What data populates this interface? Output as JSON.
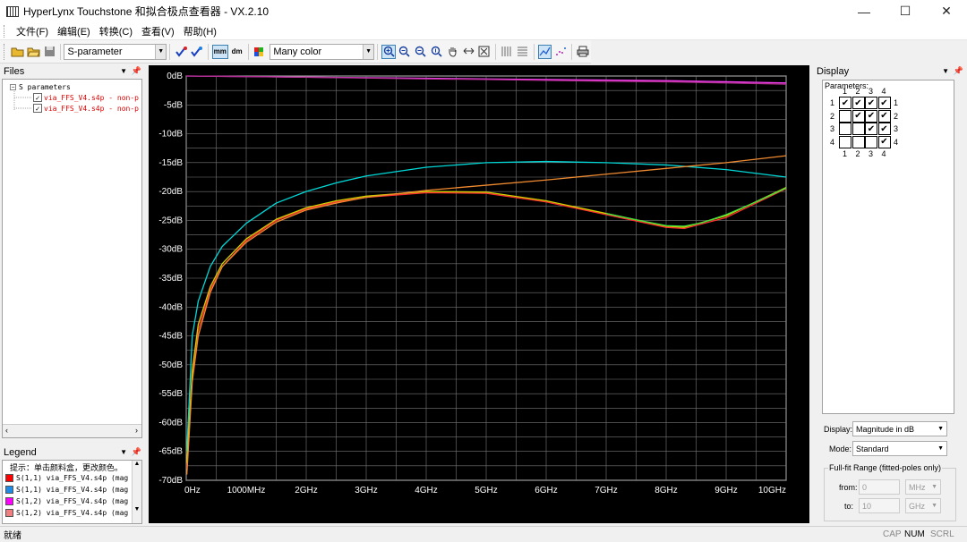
{
  "window": {
    "title": "HyperLynx Touchstone 和拟合极点查看器 - VX.2.10",
    "minimize": "—",
    "maximize": "☐",
    "close": "✕"
  },
  "menu": [
    "文件(F)",
    "编辑(E)",
    "转换(C)",
    "查看(V)",
    "帮助(H)"
  ],
  "toolbar": {
    "param_type": "S-parameter",
    "color_mode": "Many color",
    "mm_label": "mm",
    "dm_label": "dm"
  },
  "files_panel": {
    "title": "Files",
    "root": "S parameters",
    "files": [
      "via_FFS_V4.s4p - non-p",
      "via_FFS_V4.s4p - non-p"
    ]
  },
  "legend_panel": {
    "title": "Legend",
    "hint": "提示：单击颜料盒，更改颜色。",
    "entries": [
      {
        "label": "S(1,1) via_FFS_V4.s4p (mag",
        "color": "#ff0000"
      },
      {
        "label": "S(1,1) via_FFS_V4.s4p (mag",
        "color": "#1e8ce6"
      },
      {
        "label": "S(1,2) via_FFS_V4.s4p (mag",
        "color": "#ff00ff"
      },
      {
        "label": "S(1,2) via_FFS_V4.s4p (mag",
        "color": "#f08080"
      }
    ]
  },
  "chart_data": {
    "type": "line",
    "xlabel": "",
    "ylabel": "",
    "xlim": [
      0,
      10
    ],
    "ylim": [
      -70,
      0
    ],
    "x_ticks": [
      "0Hz",
      "1000MHz",
      "2GHz",
      "3GHz",
      "4GHz",
      "5GHz",
      "6GHz",
      "7GHz",
      "8GHz",
      "9GHz",
      "10GHz"
    ],
    "y_ticks": [
      "0dB",
      "-5dB",
      "-10dB",
      "-15dB",
      "-20dB",
      "-25dB",
      "-30dB",
      "-35dB",
      "-40dB",
      "-45dB",
      "-50dB",
      "-55dB",
      "-60dB",
      "-65dB",
      "-70dB"
    ],
    "grid": true,
    "x_units": "GHz",
    "series": [
      {
        "color": "#00d8d8",
        "x": [
          0.01,
          0.1,
          0.2,
          0.4,
          0.6,
          1,
          1.5,
          2,
          2.5,
          3,
          4,
          5,
          6,
          7,
          8,
          9,
          10
        ],
        "y": [
          -65,
          -45,
          -39,
          -33,
          -29.5,
          -25.5,
          -22,
          -20,
          -18.5,
          -17.3,
          -15.8,
          -15.0,
          -14.8,
          -15.0,
          -15.4,
          -16.2,
          -17.5
        ]
      },
      {
        "color": "#ff3030",
        "x": [
          0.01,
          0.1,
          0.2,
          0.4,
          0.6,
          1,
          1.5,
          2,
          2.5,
          3,
          4,
          5,
          6,
          7,
          8,
          8.3,
          9,
          10
        ],
        "y": [
          -68,
          -52,
          -44,
          -37,
          -33,
          -28.5,
          -25,
          -23,
          -21.8,
          -21,
          -20.2,
          -20.3,
          -21.8,
          -24,
          -26.2,
          -26.4,
          -24.5,
          -19.5
        ]
      },
      {
        "color": "#d0d000",
        "x": [
          0.01,
          0.1,
          0.2,
          0.4,
          0.6,
          1,
          1.5,
          2,
          2.5,
          3,
          4,
          5,
          6,
          7,
          8,
          8.3,
          9,
          10
        ],
        "y": [
          -67,
          -51,
          -43,
          -36.5,
          -32.5,
          -28.2,
          -24.8,
          -22.8,
          -21.6,
          -20.8,
          -20.0,
          -20.1,
          -21.6,
          -23.8,
          -26.0,
          -26.2,
          -24.2,
          -19.3
        ]
      },
      {
        "color": "#40e040",
        "x": [
          7,
          7.5,
          8,
          8.3,
          8.6,
          9,
          9.5,
          10
        ],
        "y": [
          -23.8,
          -24.9,
          -25.9,
          -26.0,
          -25.4,
          -24.0,
          -21.8,
          -19.4
        ]
      },
      {
        "color": "#f08a30",
        "x": [
          0.01,
          0.1,
          0.2,
          0.4,
          0.6,
          1,
          1.5,
          2,
          2.5,
          3,
          4,
          5,
          6,
          7,
          8,
          9,
          10
        ],
        "y": [
          -69,
          -53,
          -45,
          -37.5,
          -33,
          -28.8,
          -25.3,
          -23.2,
          -22,
          -21,
          -19.8,
          -18.9,
          -18.0,
          -17.0,
          -16.0,
          -15.0,
          -13.8
        ]
      },
      {
        "color": "#ff40ff",
        "x": [
          0,
          1,
          2,
          3,
          4,
          5,
          6,
          7,
          8,
          9,
          10
        ],
        "y": [
          0,
          -0.1,
          -0.2,
          -0.3,
          -0.4,
          -0.5,
          -0.6,
          -0.7,
          -0.8,
          -1.0,
          -1.2
        ]
      },
      {
        "color": "#b03090",
        "x": [
          0,
          1,
          2,
          3,
          4,
          5,
          6,
          7,
          8,
          9,
          10
        ],
        "y": [
          0,
          -0.1,
          -0.2,
          -0.35,
          -0.5,
          -0.6,
          -0.75,
          -0.9,
          -1.0,
          -1.2,
          -1.4
        ]
      }
    ]
  },
  "display_panel": {
    "title": "Display",
    "parameters_label": "Parameters:",
    "matrix": [
      [
        true,
        true,
        true,
        true
      ],
      [
        false,
        true,
        true,
        true
      ],
      [
        false,
        false,
        true,
        true
      ],
      [
        false,
        false,
        false,
        true
      ]
    ],
    "col_labels": [
      "1",
      "2",
      "3",
      "4"
    ],
    "row_labels": [
      "1",
      "2",
      "3",
      "4"
    ],
    "display_label": "Display:",
    "display_value": "Magnitude in dB",
    "mode_label": "Mode:",
    "mode_value": "Standard",
    "fullfit_label": "Full-fit Range (fitted-poles only)",
    "from_label": "from:",
    "from_value": "0",
    "from_unit": "MHz",
    "to_label": "to:",
    "to_value": "10",
    "to_unit": "GHz"
  },
  "status": {
    "text": "就绪",
    "cap": "CAP",
    "num": "NUM",
    "scrl": "SCRL"
  }
}
